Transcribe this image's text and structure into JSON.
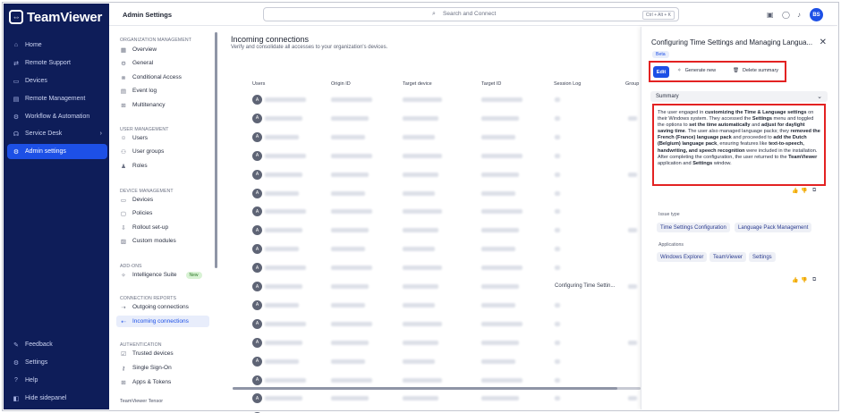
{
  "app": {
    "brand": "TeamViewer"
  },
  "leftnav": {
    "items": [
      {
        "label": "Home",
        "icon": "home-icon"
      },
      {
        "label": "Remote Support",
        "icon": "arrows-icon"
      },
      {
        "label": "Devices",
        "icon": "devices-icon"
      },
      {
        "label": "Remote Management",
        "icon": "monitor-icon"
      },
      {
        "label": "Workflow & Automation",
        "icon": "workflow-icon"
      },
      {
        "label": "Service Desk",
        "icon": "headset-icon"
      },
      {
        "label": "Admin settings",
        "icon": "gear-icon",
        "active": true
      }
    ],
    "bottom": [
      {
        "label": "Feedback",
        "icon": "feedback-icon"
      },
      {
        "label": "Settings",
        "icon": "gear-icon"
      },
      {
        "label": "Help",
        "icon": "help-icon"
      },
      {
        "label": "Hide sidepanel",
        "icon": "sidepanel-icon"
      }
    ]
  },
  "topbar": {
    "title": "Admin Settings",
    "search_placeholder": "Search and Connect",
    "search_shortcut": "Ctrl + Alt + K",
    "avatar_initials": "BS"
  },
  "settings_nav": {
    "sections": [
      {
        "title": "ORGANIZATION MANAGEMENT",
        "items": [
          "Overview",
          "General",
          "Conditional Access",
          "Event log",
          "Multitenancy"
        ]
      },
      {
        "title": "USER MANAGEMENT",
        "items": [
          "Users",
          "User groups",
          "Roles"
        ]
      },
      {
        "title": "DEVICE MANAGEMENT",
        "items": [
          "Devices",
          "Policies",
          "Rollout set-up",
          "Custom modules"
        ]
      },
      {
        "title": "ADD-ONS",
        "items": [
          "Intelligence Suite"
        ]
      },
      {
        "title": "CONNECTION REPORTS",
        "items": [
          "Outgoing connections",
          "Incoming connections"
        ]
      },
      {
        "title": "AUTHENTICATION",
        "items": [
          "Trusted devices",
          "Single Sign-On",
          "Apps & Tokens"
        ]
      }
    ],
    "new_badge": "New",
    "footer": "TeamViewer Tensor"
  },
  "main": {
    "title": "Incoming connections",
    "subtitle": "Verify and consolidate all accesses to your organization's devices.",
    "columns": [
      "Users",
      "Origin ID",
      "Target device",
      "Target ID",
      "Session Log",
      "Group"
    ],
    "row_avatar": "A",
    "row_count": 18,
    "visible_session_log": {
      "row": 10,
      "text": "Configuring Time Settin..."
    }
  },
  "panel": {
    "title": "Configuring Time Settings and Managing Langua...",
    "badge": "Beta",
    "buttons": {
      "edit": "Edit",
      "generate": "Generate new",
      "delete": "Delete summary"
    },
    "summary_label": "Summary",
    "summary": [
      {
        "t": "The user engaged in ",
        "b": false
      },
      {
        "t": "customizing the Time & Language settings",
        "b": true
      },
      {
        "t": " on their Windows system. They accessed the ",
        "b": false
      },
      {
        "t": "Settings",
        "b": true
      },
      {
        "t": " menu and toggled the options to ",
        "b": false
      },
      {
        "t": "set the time automatically",
        "b": true
      },
      {
        "t": " and ",
        "b": false
      },
      {
        "t": "adjust for daylight saving time",
        "b": true
      },
      {
        "t": ". The user also managed language packs; they ",
        "b": false
      },
      {
        "t": "removed the French (France) language pack",
        "b": true
      },
      {
        "t": " and proceeded to ",
        "b": false
      },
      {
        "t": "add the Dutch (Belgium) language pack",
        "b": true
      },
      {
        "t": ", ensuring features like ",
        "b": false
      },
      {
        "t": "text-to-speech, handwriting, and speech recognition",
        "b": true
      },
      {
        "t": " were included in the installation. After completing the configuration, the user returned to the ",
        "b": false
      },
      {
        "t": "TeamViewer",
        "b": true
      },
      {
        "t": " application and ",
        "b": false
      },
      {
        "t": "Settings",
        "b": true
      },
      {
        "t": " window.",
        "b": false
      }
    ],
    "issue_type_label": "Issue type",
    "issue_types": [
      "Time Settings Configuration",
      "Language Pack Management"
    ],
    "applications_label": "Applications",
    "applications": [
      "Windows Explorer",
      "TeamViewer",
      "Settings"
    ]
  }
}
